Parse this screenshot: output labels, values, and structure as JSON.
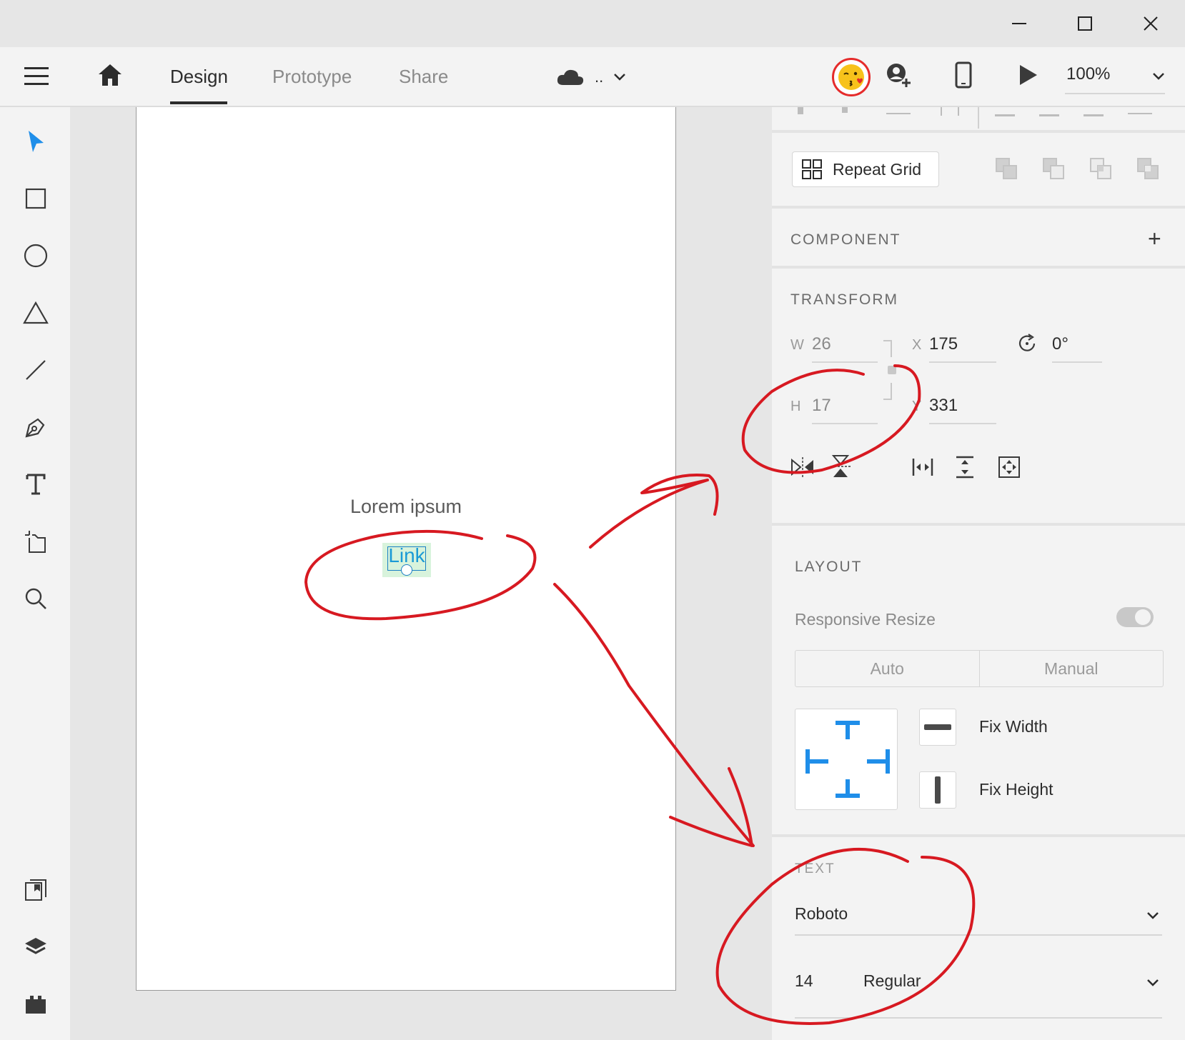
{
  "window_controls": {
    "minimize_icon": "minimize-icon",
    "maximize_icon": "maximize-icon",
    "close_icon": "close-icon"
  },
  "toolbar": {
    "tabs": [
      {
        "label": "Design",
        "active": true
      },
      {
        "label": "Prototype",
        "active": false
      },
      {
        "label": "Share",
        "active": false
      }
    ],
    "cloud_doc_label": "..",
    "zoom": "100%"
  },
  "left_tools": [
    "select-tool",
    "rectangle-tool",
    "ellipse-tool",
    "polygon-tool",
    "line-tool",
    "pen-tool",
    "text-tool",
    "artboard-tool",
    "zoom-tool"
  ],
  "left_bottom_tools": [
    "assets-panel",
    "layers-panel",
    "plugins-panel"
  ],
  "canvas": {
    "heading_text": "Lorem ipsum",
    "link_text": "Link"
  },
  "panel": {
    "repeat_grid_label": "Repeat Grid",
    "component": {
      "title": "COMPONENT",
      "add_symbol": "+"
    },
    "transform": {
      "title": "TRANSFORM",
      "w_label": "W",
      "w_value": "26",
      "h_label": "H",
      "h_value": "17",
      "x_label": "X",
      "x_value": "175",
      "y_label": "Y",
      "y_value": "331",
      "rotation_value": "0°"
    },
    "layout": {
      "title": "LAYOUT",
      "responsive_resize_label": "Responsive Resize",
      "responsive_resize_on": false,
      "mode_options": [
        "Auto",
        "Manual"
      ],
      "fix_width_label": "Fix Width",
      "fix_height_label": "Fix Height"
    },
    "text": {
      "title": "TEXT",
      "font_family": "Roboto",
      "font_size": "14",
      "font_weight": "Regular"
    }
  },
  "colors": {
    "accent_blue": "#1f8ee9",
    "annotation_red": "#d71921",
    "link_blue": "#1a9ad6",
    "selection_green": "#d8f3dc"
  }
}
